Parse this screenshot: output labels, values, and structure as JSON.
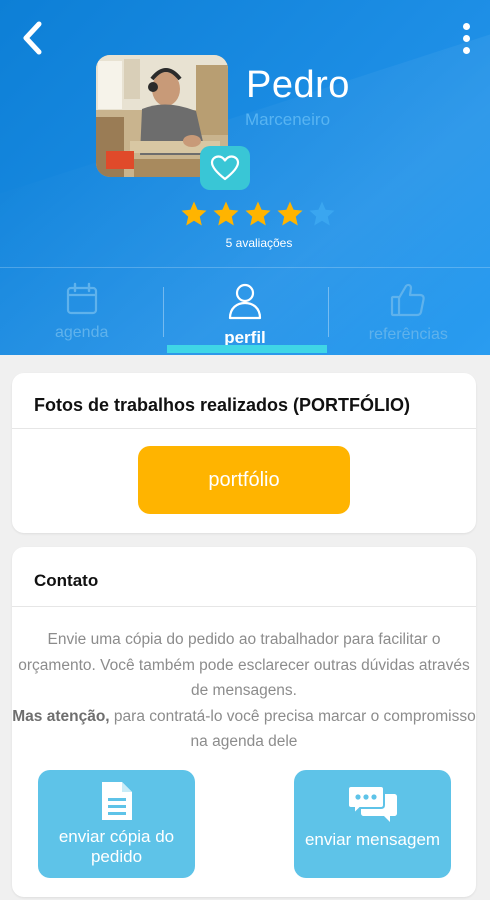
{
  "profile": {
    "name": "Pedro",
    "profession": "Marceneiro",
    "rating": 4,
    "max_rating": 5,
    "ratings_text": "5 avaliações"
  },
  "tabs": [
    {
      "label": "agenda",
      "icon": "calendar-icon",
      "active": false
    },
    {
      "label": "perfil",
      "icon": "person-icon",
      "active": true
    },
    {
      "label": "referências",
      "icon": "thumbs-up-icon",
      "active": false
    }
  ],
  "portfolio": {
    "title": "Fotos de trabalhos realizados (PORTFÓLIO)",
    "button_label": "portfólio"
  },
  "contact": {
    "title": "Contato",
    "text_line1": "Envie uma cópia do pedido ao trabalhador para facilitar o orçamento. Você também pode esclarecer outras dúvidas através de mensagens.",
    "text_bold": "Mas atenção,",
    "text_line2": " para contratá-lo você precisa marcar o compromisso na agenda dele",
    "copy_button": "enviar cópia do pedido",
    "message_button": "enviar mensagem"
  },
  "colors": {
    "header_blue": "#1a8ae0",
    "accent_cyan": "#3fd6e6",
    "star_yellow": "#ffb400",
    "portfolio_orange": "#ffb400",
    "action_blue": "#5ec3e8"
  }
}
